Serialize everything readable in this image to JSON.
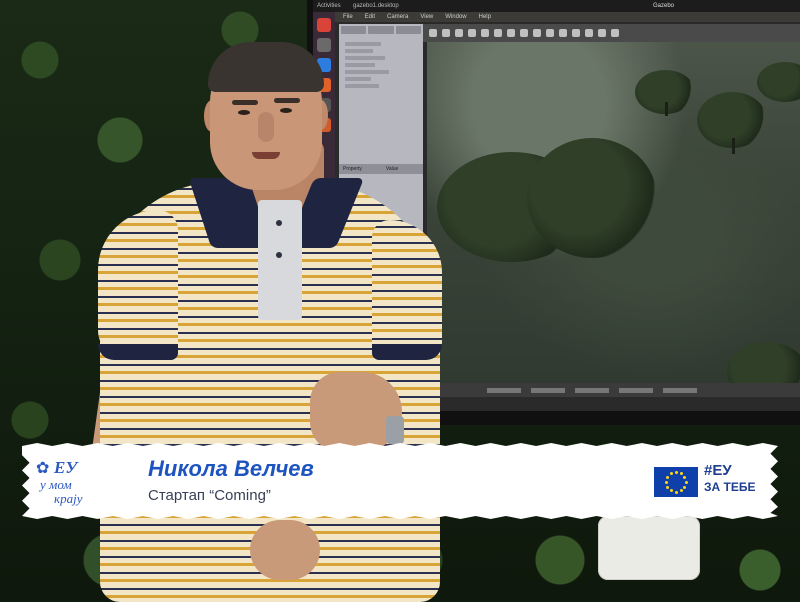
{
  "lower_third": {
    "logo_line1": "ЕУ",
    "logo_line2": "у мом",
    "logo_line3": "крају",
    "name": "Никола Велчев",
    "subtitle": "Стартап “Coming”",
    "hashtag_line1": "#ЕУ",
    "hashtag_line2": "ЗА ТЕБЕ",
    "brand_color": "#1e54c0",
    "flag_color": "#0f3fa8",
    "star_color": "#ffd617"
  },
  "monitor": {
    "topbar_left": "Activities",
    "app_name": "gazebo1.desktop",
    "window_title": "Gazebo",
    "menu": [
      "File",
      "Edit",
      "Camera",
      "View",
      "Window",
      "Help"
    ],
    "property_header": [
      "Property",
      "Value"
    ]
  },
  "icons": {
    "logo_flower": "✿"
  }
}
